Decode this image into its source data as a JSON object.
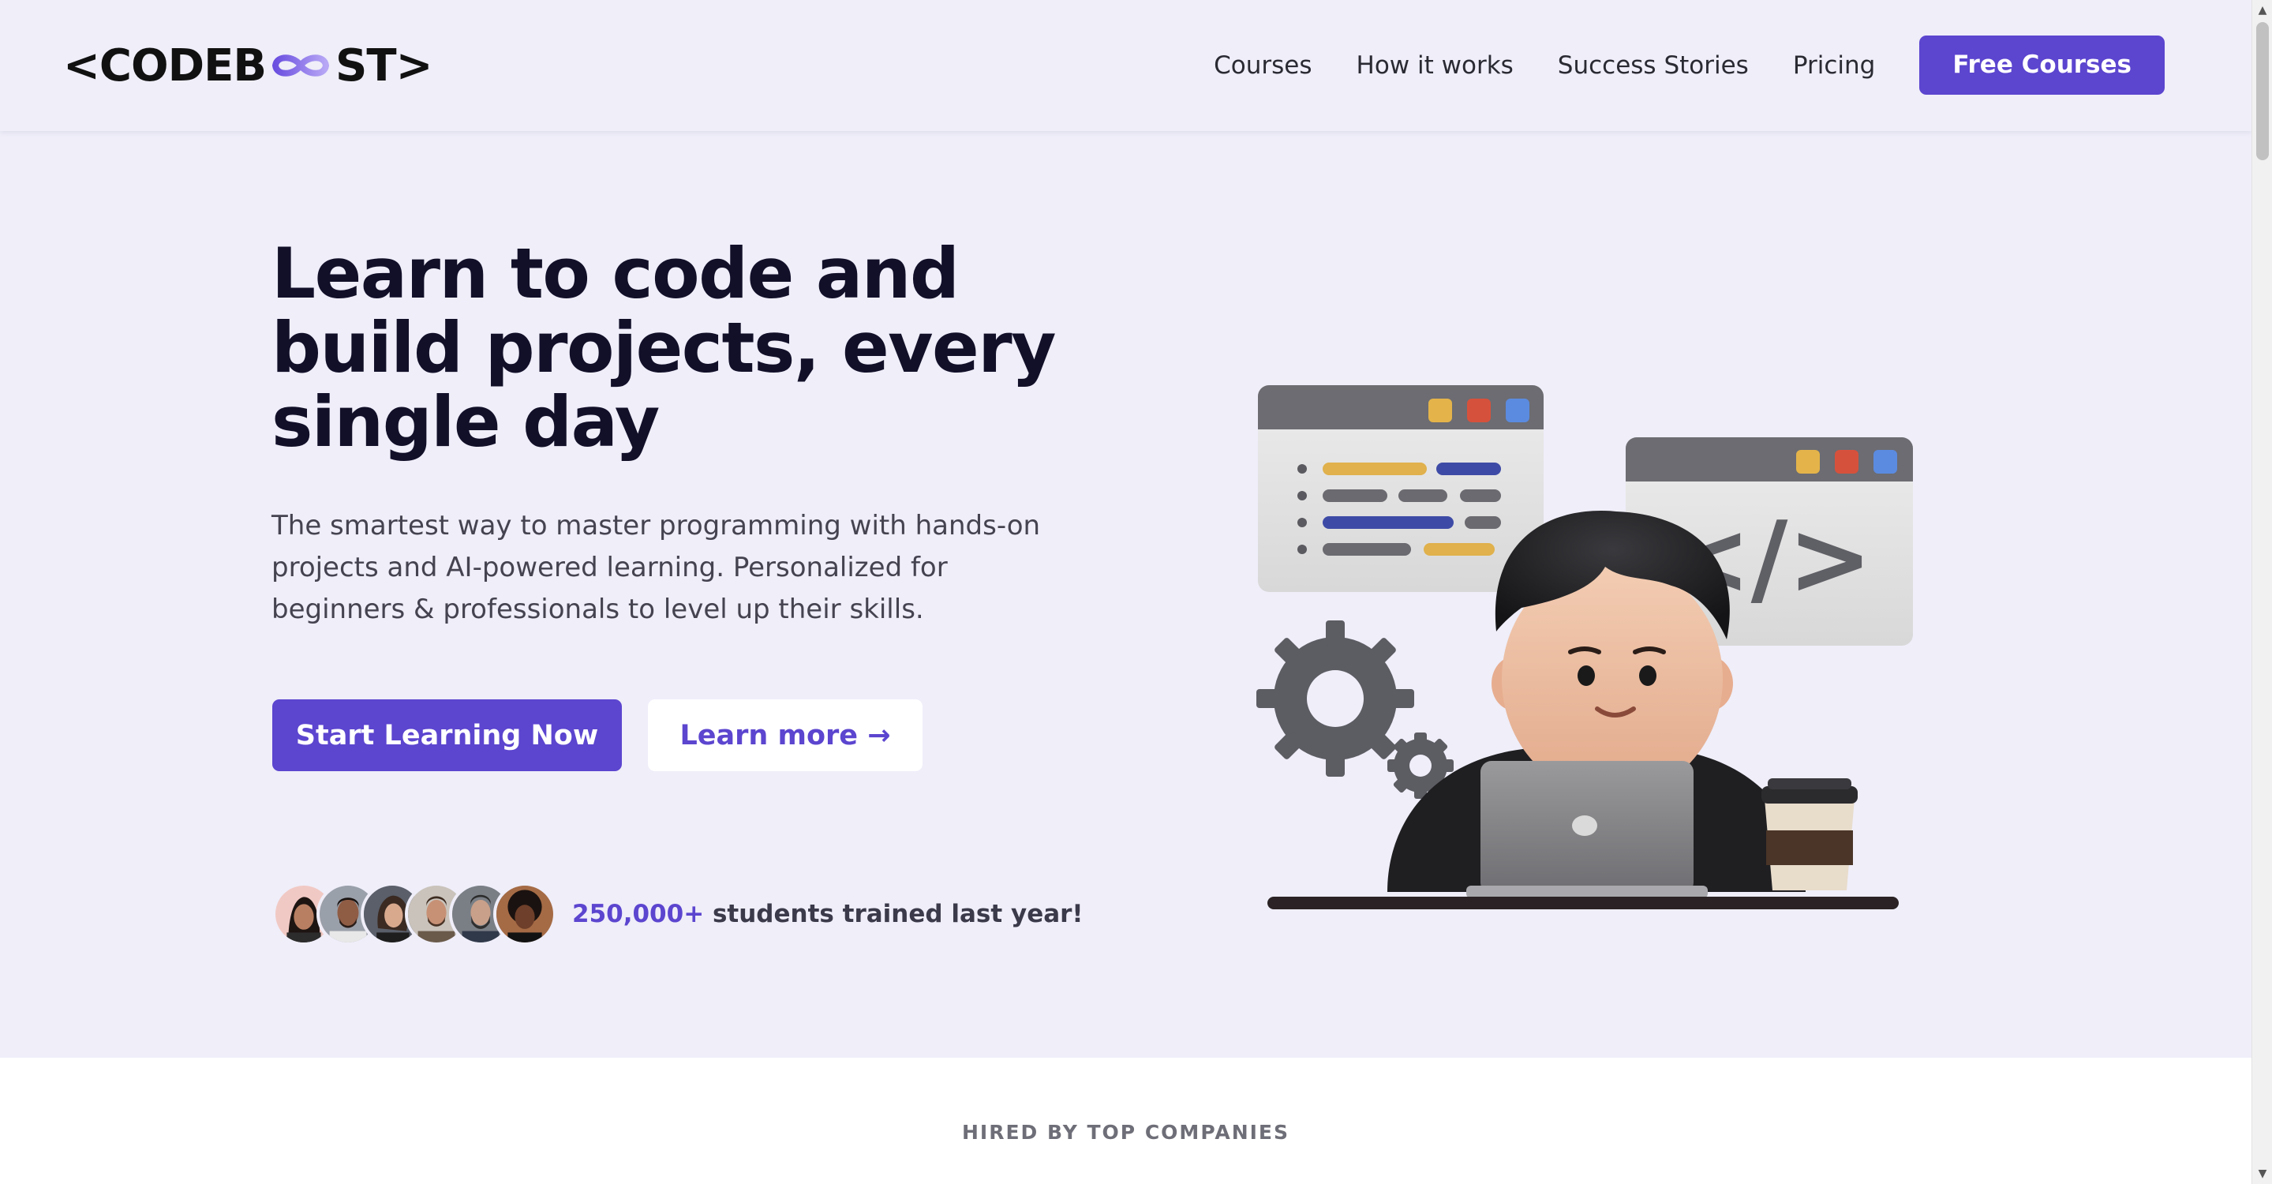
{
  "navbar": {
    "logo_before": "<CODEB",
    "logo_after": "ST>",
    "links": [
      "Courses",
      "How it works",
      "Success Stories",
      "Pricing"
    ],
    "cta_label": "Free Courses"
  },
  "hero": {
    "title": "Learn to code and build projects, every single day",
    "subtitle": "The smartest way to master programming with hands-on projects and AI-powered learning. Personalized for beginners & professionals to level up their skills.",
    "primary_button": "Start Learning Now",
    "secondary_button": "Learn more →",
    "proof_count": "250,000+",
    "proof_text": " students trained last year!"
  },
  "illustration": {
    "code_window_icon": "</>"
  },
  "companies": {
    "label": "HIRED BY TOP COMPANIES"
  },
  "scrollbar": {
    "up_icon": "▲",
    "down_icon": "▼"
  },
  "colors": {
    "accent": "#5c45cf",
    "background": "#efeef9",
    "heading": "#121029"
  }
}
